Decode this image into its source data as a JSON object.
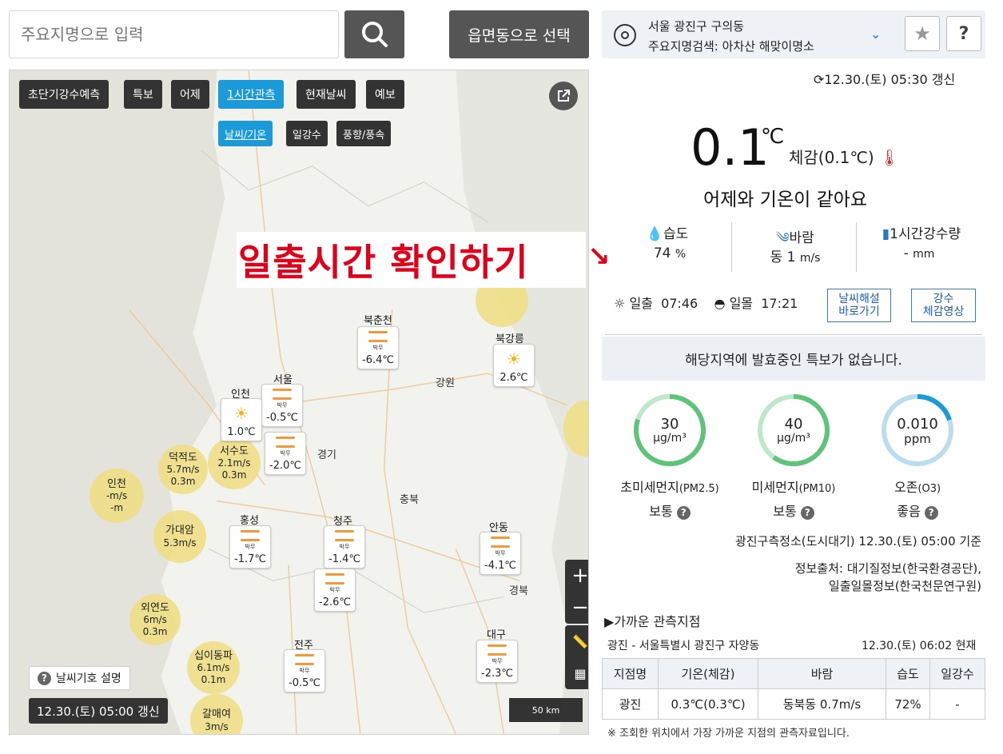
{
  "search": {
    "placeholder": "주요지명으로 입력",
    "region_button": "읍면동으로 선택"
  },
  "location": {
    "line1": "서울 광진구 구의동",
    "line2": "주요지명검색: 아차산 해맞이명소"
  },
  "updated": "12.30.(토) 05:30 갱신",
  "current": {
    "temp": "0.1",
    "unit": "℃",
    "feels": "체감(0.1℃)",
    "compare": "어제와 기온이 같아요",
    "humidity_label": "습도",
    "humidity_value": "74",
    "humidity_unit": "%",
    "wind_label": "바람",
    "wind_dir": "동",
    "wind_speed": "1",
    "wind_unit": "m/s",
    "rain_label": "1시간강수량",
    "rain_value": "-",
    "rain_unit": "mm"
  },
  "sun": {
    "sunrise_label": "일출",
    "sunrise": "07:46",
    "sunset_label": "일몰",
    "sunset": "17:21"
  },
  "buttons": {
    "weather_explain": "날씨해설\n바로가기",
    "rain_video": "강수\n체감영상"
  },
  "notice": "해당지역에 발효중인 특보가 없습니다.",
  "air": [
    {
      "value": "30",
      "unit": "μg/m³",
      "label": "초미세먼지",
      "sub": "(PM2.5)",
      "status": "보통",
      "fraction": 0.8,
      "color": "#5dc47a"
    },
    {
      "value": "40",
      "unit": "μg/m³",
      "label": "미세먼지",
      "sub": "(PM10)",
      "status": "보통",
      "fraction": 0.6,
      "color": "#5dc47a"
    },
    {
      "value": "0.010",
      "unit": "ppm",
      "label": "오존",
      "sub": "(O3)",
      "status": "좋음",
      "fraction": 0.2,
      "color": "#1a9ad8"
    }
  ],
  "station": "광진구측정소(도시대기) 12.30.(토) 05:00 기준",
  "source1": "정보출처: 대기질정보(한국환경공단),",
  "source2": "일출일몰정보(한국천문연구원)",
  "nearby": {
    "title": "▶가까운 관측지점",
    "location": "광진 - 서울특별시 광진구 자양동",
    "time": "12.30.(토) 06:02 현재",
    "headers": [
      "지점명",
      "기온(체감)",
      "바람",
      "습도",
      "일강수"
    ],
    "row": [
      "광진",
      "0.3℃(0.3℃)",
      "동북동 0.7m/s",
      "72%",
      "-"
    ],
    "footnote": "※ 조회한 위치에서 가장 가까운 지점의 관측자료입니다."
  },
  "annotation": "일출시간 확인하기",
  "map": {
    "tabs": [
      "초단기강수예측",
      "특보",
      "어제",
      "1시간관측",
      "현재날씨",
      "예보"
    ],
    "subtabs": [
      "날씨/기온",
      "일강수",
      "풍향/풍속"
    ],
    "update": "12.30.(토) 05:00 갱신",
    "legend": "날씨기호 설명",
    "scale": "50 km",
    "haze_label": "박무",
    "cards": [
      {
        "city": "북춘천",
        "temp": "-6.4℃"
      },
      {
        "city": "북강릉",
        "temp": "2.6℃"
      },
      {
        "city": "서울",
        "temp": "-0.5℃"
      },
      {
        "city": "인천",
        "temp": "1.0℃"
      },
      {
        "city": "",
        "temp": "-2.0℃"
      },
      {
        "city": "홍성",
        "temp": "-1.7℃"
      },
      {
        "city": "청주",
        "temp": "-1.4℃"
      },
      {
        "city": "",
        "temp": "-2.6℃"
      },
      {
        "city": "안동",
        "temp": "-4.1℃"
      },
      {
        "city": "전주",
        "temp": "-0.5℃"
      },
      {
        "city": "대구",
        "temp": "-2.3℃"
      }
    ],
    "circles": [
      {
        "name": "덕적도",
        "l1": "5.7m/s",
        "l2": "0.3m"
      },
      {
        "name": "서수도",
        "l1": "2.1m/s",
        "l2": "0.3m"
      },
      {
        "name": "인천",
        "l1": "-m/s",
        "l2": "-m"
      },
      {
        "name": "가대암",
        "l1": "5.3m/s",
        "l2": ""
      },
      {
        "name": "외연도",
        "l1": "6m/s",
        "l2": "0.3m"
      },
      {
        "name": "십이동파",
        "l1": "6.1m/s",
        "l2": "0.1m"
      },
      {
        "name": "갈매여",
        "l1": "3m/s",
        "l2": ""
      }
    ],
    "regions": [
      "강원",
      "경기",
      "충북",
      "경북"
    ]
  }
}
